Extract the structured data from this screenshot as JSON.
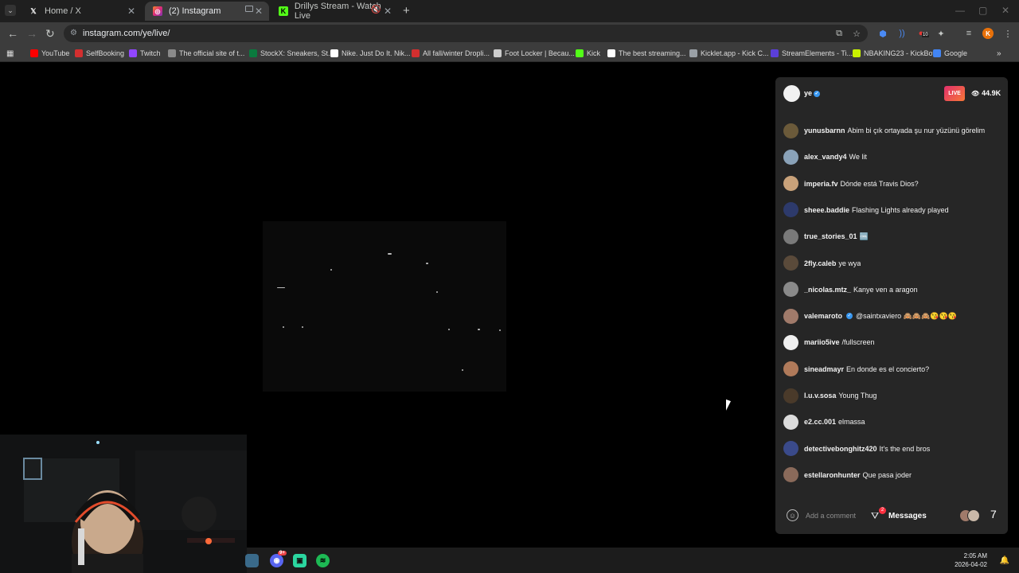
{
  "tabs": [
    {
      "title": "Home / X",
      "icon": "x-logo-icon",
      "active": false
    },
    {
      "title": "(2) Instagram",
      "icon": "instagram-icon",
      "active": true
    },
    {
      "title": "Drillys Stream - Watch Live",
      "icon": "kick-icon",
      "active": false
    }
  ],
  "toolbar": {
    "url": "instagram.com/ye/live/",
    "profile_initial": "K",
    "extension_badge": "10"
  },
  "bookmarks": [
    {
      "label": "YouTube",
      "color": "#ff0000"
    },
    {
      "label": "SelfBooking",
      "color": "#d32f2f"
    },
    {
      "label": "Twitch",
      "color": "#9146ff"
    },
    {
      "label": "The official site of t...",
      "color": "#8a8a8a"
    },
    {
      "label": "StockX: Sneakers, St...",
      "color": "#0a7a3e"
    },
    {
      "label": "Nike. Just Do It. Nik...",
      "color": "#ffffff"
    },
    {
      "label": "All fall/winter Dropli...",
      "color": "#d32f2f"
    },
    {
      "label": "Foot Locker | Becau...",
      "color": "#cccccc"
    },
    {
      "label": "Kick",
      "color": "#53fc18"
    },
    {
      "label": "The best streaming...",
      "color": "#ffffff"
    },
    {
      "label": "Kicklet.app - Kick C...",
      "color": "#9aa0a6"
    },
    {
      "label": "StreamElements - Ti...",
      "color": "#5b3fd9"
    },
    {
      "label": "NBAKING23 - KickBot",
      "color": "#c9f200"
    },
    {
      "label": "Google",
      "color": "#4285f4"
    }
  ],
  "chat": {
    "host": "ye",
    "live_label": "LIVE",
    "viewer_count": "44.9K",
    "comments": [
      {
        "user": "yunusbarnn",
        "text": "Abim bi çık ortayada şu nur yüzünü görelim",
        "avatar_color": "#6b5a3a"
      },
      {
        "user": "alex_vandy4",
        "text": "We lit",
        "avatar_color": "#8aa2b8"
      },
      {
        "user": "imperia.fv",
        "text": "Dónde está Travis Dios?",
        "avatar_color": "#c9a27a"
      },
      {
        "user": "sheee.baddie",
        "text": "Flashing Lights already played",
        "avatar_color": "#2d3a6b"
      },
      {
        "user": "true_stories_01",
        "text": "🆒",
        "avatar_color": "#7a7a7a"
      },
      {
        "user": "2fly.caleb",
        "text": "ye wya",
        "avatar_color": "#5a4a3a"
      },
      {
        "user": "_nicolas.mtz_",
        "text": "Kanye ven a aragon",
        "avatar_color": "#8a8a8a"
      },
      {
        "user": "valemaroto",
        "text": "@saintxaviero 🙈🙈🙈😘😘😘",
        "avatar_color": "#a07a6a"
      },
      {
        "user": "mariio5ive",
        "text": "/fullscreen",
        "avatar_color": "#f0f0f0"
      },
      {
        "user": "sineadmayr",
        "text": "En donde es el concierto?",
        "avatar_color": "#b07a5a"
      },
      {
        "user": "l.u.v.sosa",
        "text": "Young Thug",
        "avatar_color": "#4a3a2a"
      },
      {
        "user": "e2.cc.001",
        "text": "elmassa",
        "avatar_color": "#dcdcdc"
      },
      {
        "user": "detectivebonghitz420",
        "text": "It's the end bros",
        "avatar_color": "#3a4a8a"
      },
      {
        "user": "estellaronhunter",
        "text": "Que pasa joder",
        "avatar_color": "#8a6a5a"
      }
    ],
    "comment_placeholder": "Add a comment",
    "messages_label": "Messages",
    "messages_badge": "2",
    "side_glyph": "7"
  },
  "taskbar": {
    "discord_badge": "9+",
    "time": "2:05 AM",
    "date": "2026-04-02"
  }
}
